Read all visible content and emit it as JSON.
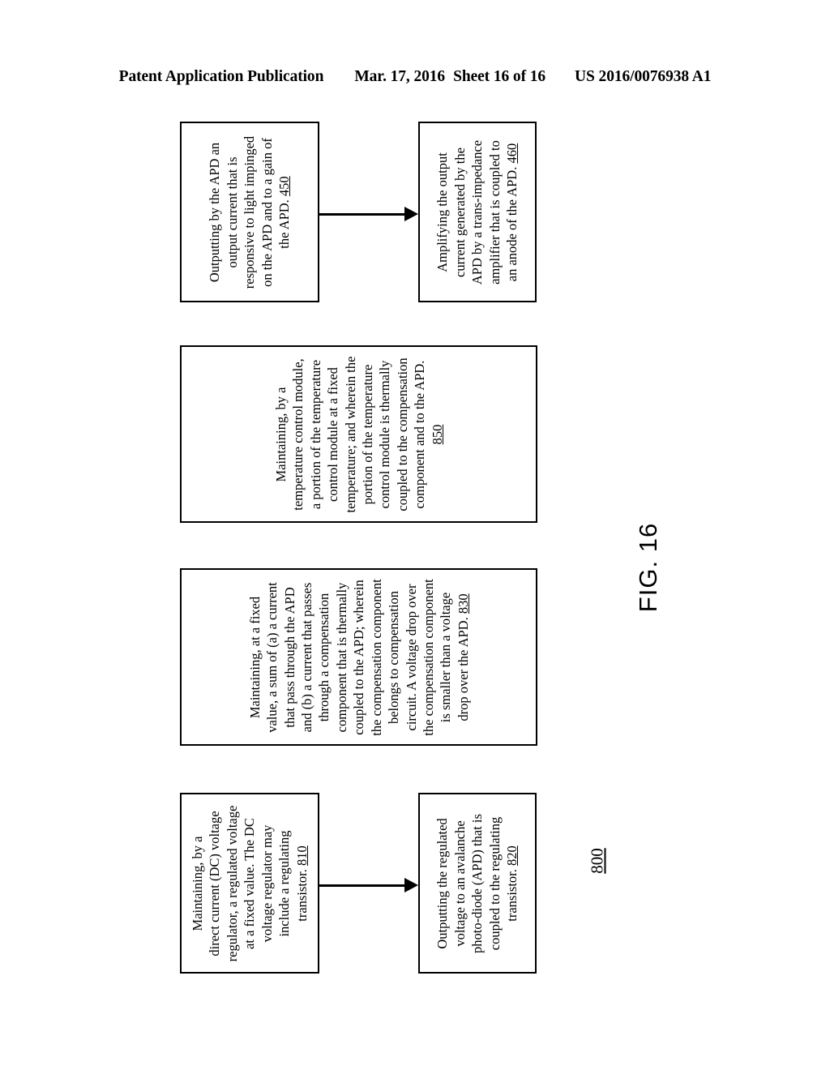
{
  "header": {
    "publication": "Patent Application Publication",
    "date": "Mar. 17, 2016",
    "sheet": "Sheet 16 of 16",
    "publication_number": "US 2016/0076938 A1"
  },
  "figure": {
    "label": "FIG. 16",
    "diagram_reference": "800"
  },
  "boxes": [
    {
      "id": "450",
      "text": "Outputting by the APD an\noutput current that is\nresponsive to light impinged\non the APD and to a gain of\nthe APD. ",
      "ref": "450"
    },
    {
      "id": "460",
      "text": "Amplifying the output\ncurrent generated by the\nAPD by a trans-impedance\namplifier that is coupled to\nan anode of the APD. ",
      "ref": "460"
    },
    {
      "id": "850",
      "text": "Maintaining, by a\ntemperature control module,\na portion of the temperature\ncontrol module at a fixed\ntemperature; and wherein the\nportion of the temperature\ncontrol module is thermally\ncoupled to the compensation\ncomponent and to the APD.\n",
      "ref": "850"
    },
    {
      "id": "830",
      "text": "Maintaining, at a fixed\nvalue, a sum of (a) a current\nthat pass through the APD\nand (b) a current that passes\nthrough a compensation\ncomponent that is thermally\ncoupled to the APD; wherein\nthe compensation component\nbelongs to compensation\ncircuit. A voltage drop over\nthe compensation component\nis smaller than a voltage\ndrop over the APD. ",
      "ref": "830"
    },
    {
      "id": "810",
      "text": "Maintaining, by a\ndirect current (DC) voltage\nregulator, a regulated voltage\nat a fixed value. The DC\nvoltage regulator may\ninclude a regulating\ntransistor. ",
      "ref": "810"
    },
    {
      "id": "820",
      "text": "Outputting the regulated\nvoltage to an avalanche\nphoto-diode (APD) that is\ncoupled to the regulating\ntransistor. ",
      "ref": "820"
    }
  ],
  "colors": {
    "ink": "#000000",
    "paper": "#ffffff"
  }
}
